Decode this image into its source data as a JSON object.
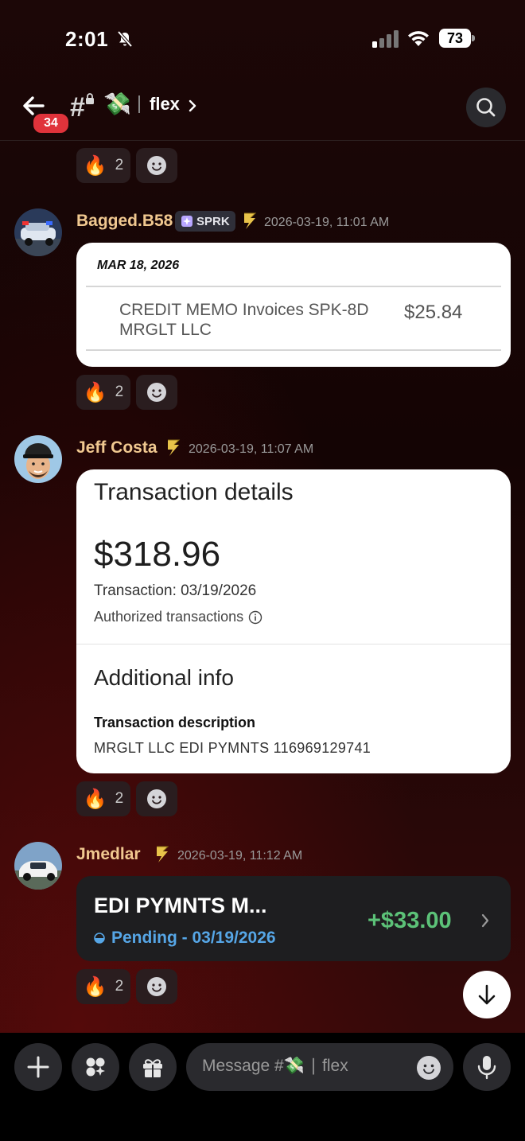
{
  "status_bar": {
    "time": "2:01",
    "battery": "73"
  },
  "header": {
    "unread_badge": "34",
    "channel_emoji": "💸",
    "channel_name": "flex"
  },
  "reactions": {
    "emoji": "🔥",
    "count": "2"
  },
  "messages": [
    {
      "username": "Bagged.B58",
      "tag": "SPRK",
      "timestamp": "2026-03-19, 11:01 AM",
      "card": {
        "date": "MAR 18, 2026",
        "description": "CREDIT MEMO Invoices SPK-8D MRGLT LLC",
        "amount": "$25.84"
      }
    },
    {
      "username": "Jeff Costa",
      "timestamp": "2026-03-19, 11:07 AM",
      "card": {
        "title": "Transaction details",
        "amount": "$318.96",
        "transaction_date": "Transaction: 03/19/2026",
        "authorized": "Authorized transactions",
        "additional_title": "Additional info",
        "desc_label": "Transaction description",
        "desc_value": "MRGLT LLC EDI PYMNTS 116969129741"
      }
    },
    {
      "username": "Jmedlar",
      "timestamp": "2026-03-19, 11:12 AM",
      "card": {
        "title": "EDI PYMNTS M...",
        "status": "Pending - 03/19/2026",
        "amount": "+$33.00"
      }
    }
  ],
  "composer": {
    "placeholder": "Message #💸 ∣ flex"
  },
  "colors": {
    "accent_name": "#f0c890",
    "badge": "#e0333b",
    "positive": "#5cc278",
    "pending": "#56a6e6"
  }
}
